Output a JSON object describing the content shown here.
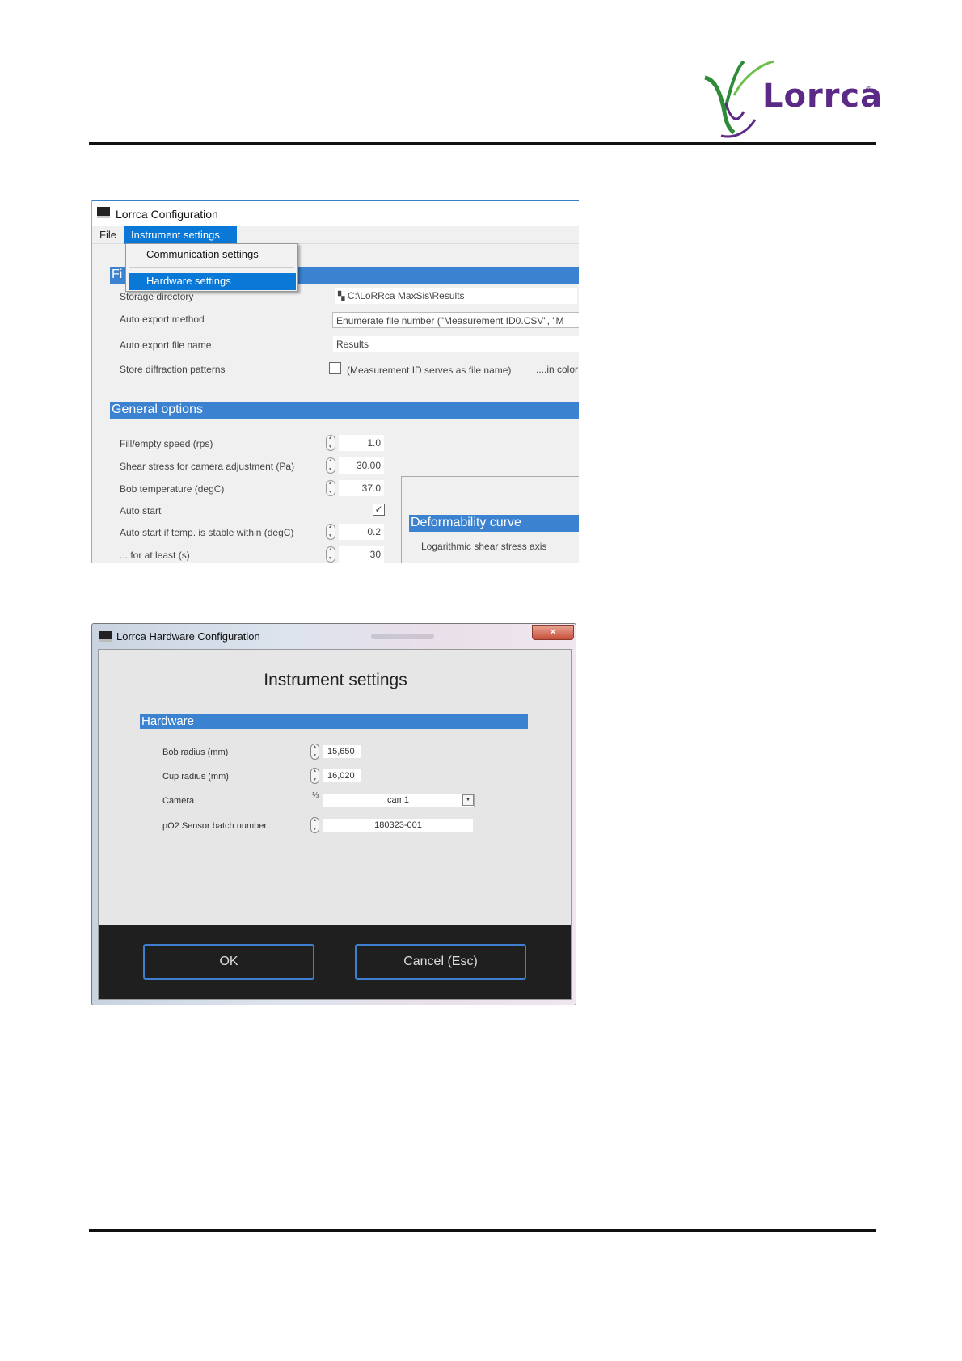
{
  "logo": {
    "text": "Lorrca",
    "reg": "®"
  },
  "config_window": {
    "title": "Lorrca Configuration",
    "menu": {
      "file": "File",
      "instrument_settings": "Instrument settings"
    },
    "dropdown": {
      "communication": "Communication settings",
      "hardware": "Hardware settings"
    },
    "files_band_fragment": "Fi",
    "storage_label": "Storage directory",
    "storage_value": "C:\\LoRRca MaxSis\\Results",
    "export_method_label": "Auto export method",
    "export_method_value": "Enumerate file number (\"Measurement ID0.CSV\", \"M",
    "export_name_label": "Auto export file name",
    "export_name_value": "Results",
    "diffraction_label": "Store diffraction patterns",
    "diffraction_note": "(Measurement ID serves as file name)",
    "diffraction_color": "....in color",
    "general_band": "General options",
    "fill_speed_label": "Fill/empty speed (rps)",
    "fill_speed_value": "1.0",
    "shear_label": "Shear stress for camera adjustment (Pa)",
    "shear_value": "30.00",
    "bob_temp_label": "Bob temperature (degC)",
    "bob_temp_value": "37.0",
    "auto_start_label": "Auto start",
    "auto_start_checked": "✓",
    "auto_stable_label": "Auto start if temp. is stable within (degC)",
    "auto_stable_value": "0.2",
    "at_least_label": "... for at least (s)",
    "at_least_value": "30",
    "deform_band": "Deformability curve",
    "log_axis_label": "Logarithmic shear stress axis"
  },
  "hardware_window": {
    "title": "Lorrca Hardware Configuration",
    "close": "✕",
    "heading": "Instrument settings",
    "band": "Hardware",
    "bob_radius_label": "Bob radius (mm)",
    "bob_radius_value": "15,650",
    "cup_radius_label": "Cup radius (mm)",
    "cup_radius_value": "16,020",
    "camera_label": "Camera",
    "camera_value": "cam1",
    "po2_label": "pO2 Sensor batch number",
    "po2_value": "180323-001",
    "ok": "OK",
    "cancel": "Cancel (Esc)"
  }
}
